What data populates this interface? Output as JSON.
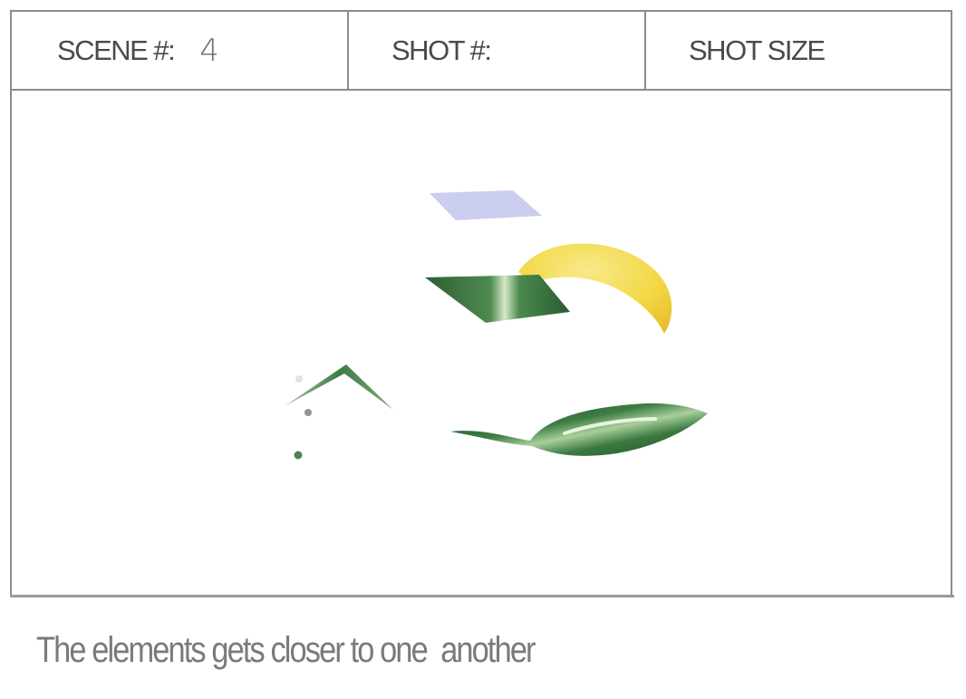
{
  "header": {
    "scene_label": "SCENE #:",
    "scene_value": "4",
    "shot_label": "SHOT #:",
    "shot_size_label": "SHOT SIZE"
  },
  "frame": {
    "elements": [
      {
        "name": "lavender-parallelogram",
        "color": "#c9cbef"
      },
      {
        "name": "yellow-crescent",
        "color": "#f2d23c"
      },
      {
        "name": "green-parallelogram",
        "color": "#3f7a45"
      },
      {
        "name": "green-chevron",
        "color": "#4f8a52"
      },
      {
        "name": "green-leaf",
        "color": "#2f6b35"
      },
      {
        "name": "small-dots",
        "color": "#5f8f5c"
      }
    ]
  },
  "caption": "The elements gets closer to one  another"
}
